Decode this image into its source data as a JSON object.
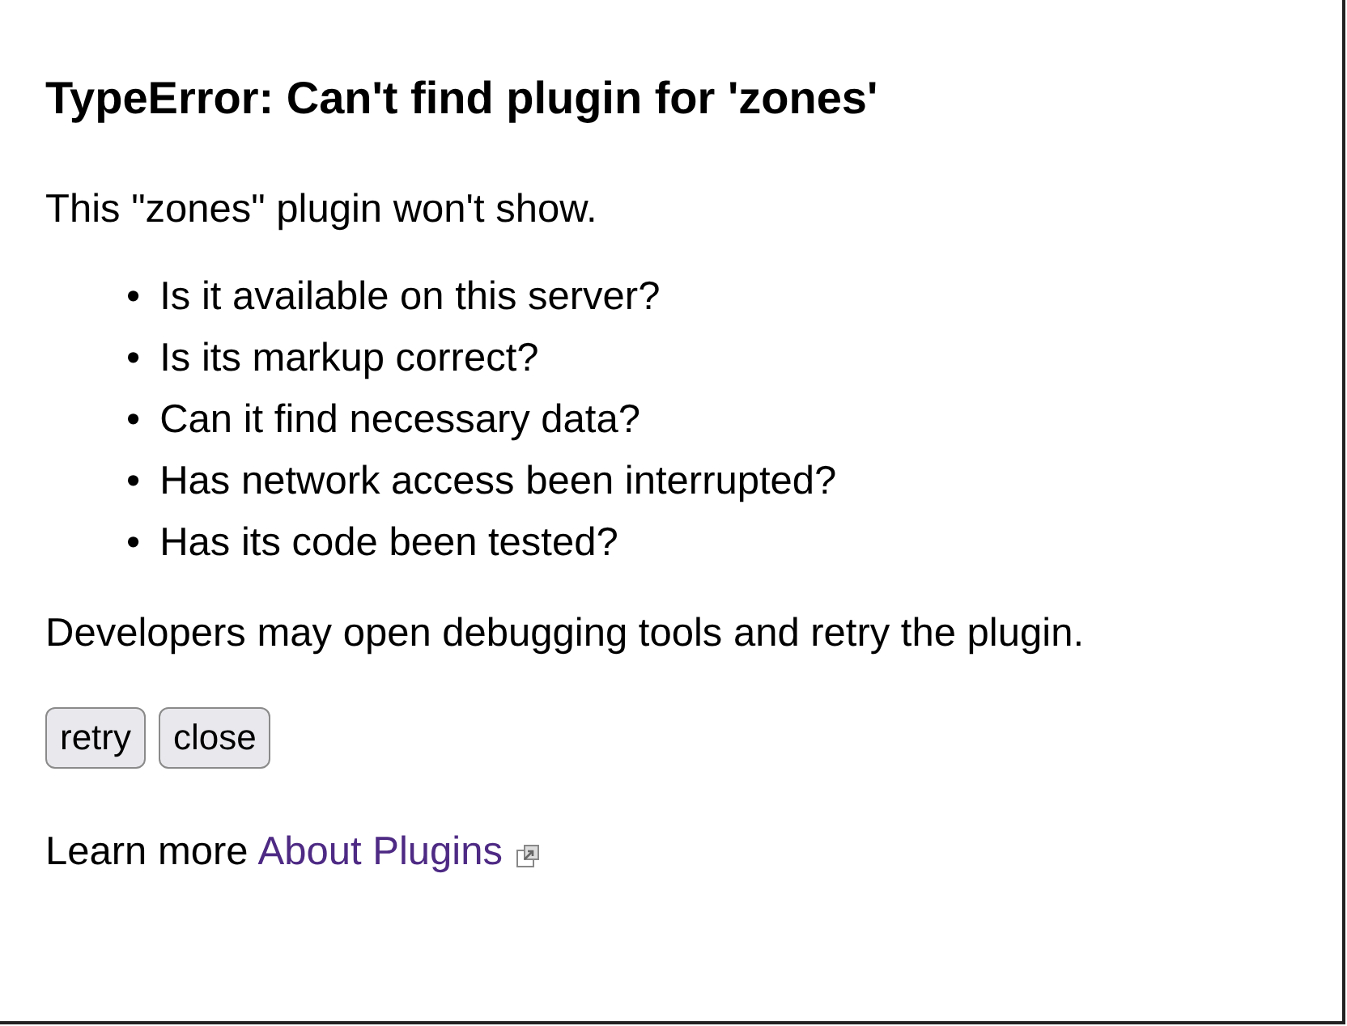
{
  "title": "TypeError: Can't find plugin for 'zones'",
  "intro": "This \"zones\" plugin won't show.",
  "checklist": [
    {
      "marker": "•",
      "text": "Is it available on this server?"
    },
    {
      "marker": "•",
      "text": "Is its markup correct?"
    },
    {
      "marker": "•",
      "text": "Can it find necessary data?"
    },
    {
      "marker": "•",
      "text": "Has network access been interrupted?"
    },
    {
      "marker": "•",
      "text": "Has its code been tested?"
    }
  ],
  "advice": "Developers may open debugging tools and retry the plugin.",
  "buttons": [
    "retry",
    "close"
  ],
  "learn_more": {
    "label": "Learn more",
    "link": "About Plugins"
  }
}
